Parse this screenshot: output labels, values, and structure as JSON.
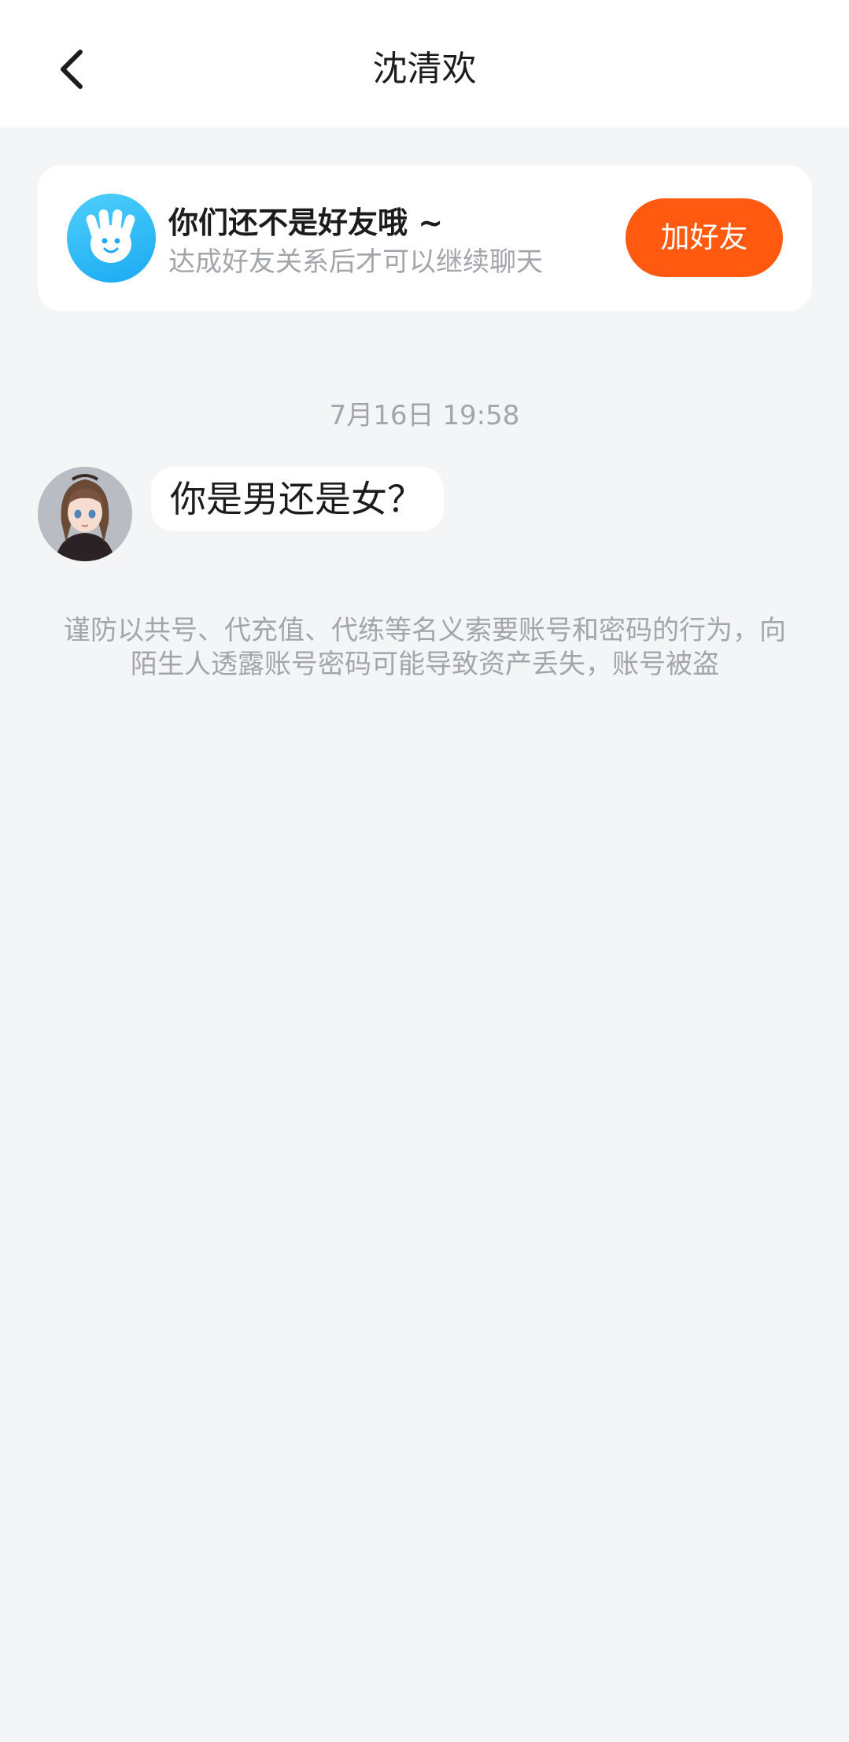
{
  "header": {
    "title": "沈清欢"
  },
  "friend_card": {
    "title": "你们还不是好友哦 ~",
    "subtitle": "达成好友关系后才可以继续聊天",
    "button_label": "加好友"
  },
  "chat": {
    "timestamp": "7月16日 19:58",
    "messages": [
      {
        "text": "你是男还是女？"
      }
    ]
  },
  "notice": {
    "text": "谨防以共号、代充值、代练等名义索要账号和密码的行为，向陌生人透露账号密码可能导致资产丢失，账号被盗"
  },
  "colors": {
    "accent": "#ff5a0f",
    "page_bg": "#f4f5f7",
    "wave_icon": "#22b1f5"
  }
}
